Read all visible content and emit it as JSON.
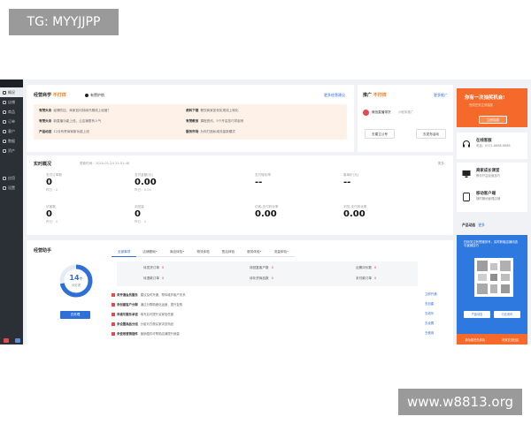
{
  "watermark_top": "TG: MYYJJPP",
  "watermark_bottom": "www.w8813.org",
  "sidebar": {
    "items": [
      {
        "label": "概况",
        "active": true
      },
      {
        "label": "店铺"
      },
      {
        "label": "商品"
      },
      {
        "label": "订单"
      },
      {
        "label": "客户"
      },
      {
        "label": "数据"
      },
      {
        "label": "资产"
      },
      {
        "label": "应用"
      },
      {
        "label": "设置"
      }
    ]
  },
  "notice": {
    "title": "经营商学",
    "title_badge": "不打烊",
    "subtitle": "有赞护航",
    "link": "更多经营建议",
    "rows": [
      {
        "tag": "有赞头条",
        "text": "疫情防控，商家如何持续开展线上经营？"
      },
      {
        "tag": "资料下载",
        "text": "餐饮商家如何实现线上转化"
      },
      {
        "tag": "有赞头条",
        "text": "新直播功能上线，让店铺更有人气"
      },
      {
        "tag": "有赞教育",
        "text": "课程资讯，5个开店技巧学起来"
      },
      {
        "tag": "产品动态",
        "text": "12月有赞商家新功能上线"
      },
      {
        "tag": "服务市场",
        "text": "为你打造私域流量新模式"
      }
    ]
  },
  "promo": {
    "title": "推广",
    "badge": "不打烊",
    "link": "更多推广",
    "row_text": "微信直播带货",
    "row_meta": "小程序推广",
    "btn_left": "去建立公号",
    "btn_right": "去发布活动"
  },
  "realtime": {
    "title": "实时概况",
    "meta": "更新时间：2020-01-24 23:51:46",
    "link": "更多",
    "stats": [
      {
        "label": "支付订单数",
        "value": "0",
        "sub": "昨日：0"
      },
      {
        "label": "支付金额(元)",
        "value": "0.00",
        "sub": "昨日：0.00"
      },
      {
        "label": "支付转化率",
        "value": "--",
        "sub": ""
      },
      {
        "label": "客单价(元)",
        "value": "--",
        "sub": ""
      },
      {
        "label": "访客数",
        "value": "0",
        "sub": "昨日：0"
      },
      {
        "label": "浏览量",
        "value": "0",
        "sub": "昨日：0"
      },
      {
        "label": "访客-支付转化率",
        "value": "0.00",
        "sub": ""
      },
      {
        "label": "浏览-支付转化率",
        "value": "0.00",
        "sub": ""
      }
    ]
  },
  "helper": {
    "title": "经营助手",
    "ring_value": "14",
    "ring_unit": "个",
    "ring_caption": "待处理",
    "ring_progress": 0.72,
    "solve_btn": "去处理",
    "tabs": [
      {
        "label": "全部事项",
        "active": true
      },
      {
        "label": "店铺基础",
        "badge": "•"
      },
      {
        "label": "商品体验",
        "badge": "•"
      },
      {
        "label": "物流体验"
      },
      {
        "label": "售后体验"
      },
      {
        "label": "服务体验",
        "badge": "•"
      },
      {
        "label": "流量体验",
        "badge": "•"
      }
    ],
    "grid": [
      {
        "label": "待发货订单",
        "value": "0"
      },
      {
        "label": "待回复客户数",
        "value": "0"
      },
      {
        "label": "近期评价数",
        "value": "0"
      },
      {
        "label": "待退款订单",
        "value": "0"
      },
      {
        "label": "待补货商品数",
        "value": "0"
      },
      {
        "label": "未付款订单",
        "value": "0"
      }
    ],
    "tasks": [
      {
        "title": "未开通会员服务",
        "text": "建议及时开通，帮你维护客户关系",
        "link": "立即开通"
      },
      {
        "title": "未创建客户分群",
        "text": "通过分群精细化运营，提升复购",
        "link": "去创建"
      },
      {
        "title": "未填写服务承诺",
        "text": "填写后可提升买家信任度",
        "link": "去填写"
      },
      {
        "title": "未设置商品分组",
        "text": "分组可方便买家浏览商品",
        "link": "去设置"
      },
      {
        "title": "未使用营销插件",
        "text": "营销插件可帮助店铺提升销量",
        "link": "去使用"
      }
    ]
  },
  "right": {
    "orange_title": "你有一次抽奖机会!",
    "orange_sub": "完成任务立即抽奖",
    "orange_btn": "立即抽奖",
    "service1_title": "在线客服",
    "service1_sub": "电话：0571-8888-8888",
    "service2_title": "商家成长课堂",
    "service2_sub": "教你开店经营技巧",
    "service3_title": "移动客户端",
    "service3_sub": "随时随地管理店铺",
    "dyn_title": "产品动态",
    "dyn_link": "更多",
    "qr_text": "扫码关注有赞服务号，实时获取店铺动态与营销技巧",
    "qr_btn_left": "产品动态",
    "qr_btn_right": "行业资讯",
    "qr_bottom_left": "新功能抢先体验",
    "qr_bottom_right": "商家交流社区"
  }
}
